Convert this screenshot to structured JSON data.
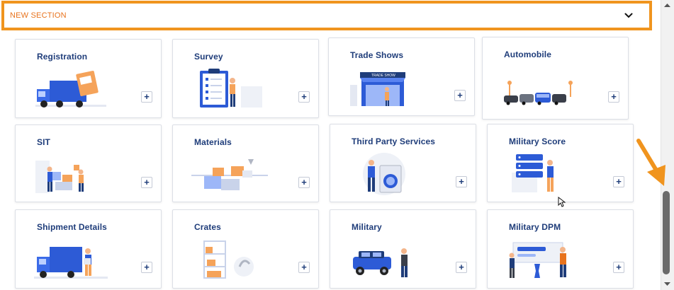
{
  "section": {
    "title": "NEW SECTION",
    "toggle_icon": "chevron-down-icon"
  },
  "cards": [
    {
      "label": "Registration",
      "icon": "truck-illustration"
    },
    {
      "label": "Survey",
      "icon": "clipboard-illustration"
    },
    {
      "label": "Trade Shows",
      "icon": "booth-illustration"
    },
    {
      "label": "Automobile",
      "icon": "cars-illustration"
    },
    {
      "label": "SIT",
      "icon": "warehouse-illustration"
    },
    {
      "label": "Materials",
      "icon": "boxes-illustration"
    },
    {
      "label": "Third Party Services",
      "icon": "washing-machine-illustration"
    },
    {
      "label": "Military Score",
      "icon": "checklist-illustration"
    },
    {
      "label": "Shipment Details",
      "icon": "delivery-truck-illustration"
    },
    {
      "label": "Crates",
      "icon": "crates-illustration"
    },
    {
      "label": "Military",
      "icon": "jeep-illustration"
    },
    {
      "label": "Military DPM",
      "icon": "presentation-illustration"
    }
  ],
  "add_label": "+",
  "colors": {
    "accent": "#f0941e",
    "title_text": "#e8731d",
    "card_title": "#1f3d7a",
    "illustration_blue": "#2d5bd6"
  }
}
